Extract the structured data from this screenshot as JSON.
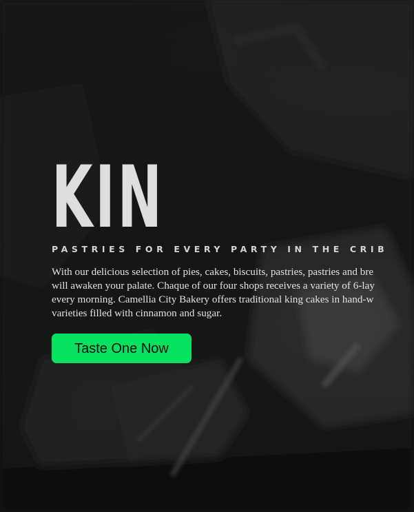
{
  "hero": {
    "title": "KIN",
    "subtitle": "PASTRIES FOR EVERY PARTY IN THE CRIB",
    "description_lines": [
      "With our delicious selection of pies, cakes, biscuits, pastries, pastries and bre",
      "will awaken your palate. Chaque of our four shops receives a variety of 6-lay",
      "every morning. Camellia City Bakery offers traditional king cakes in hand-w",
      "varieties filled with cinnamon and sugar."
    ],
    "cta_label": "Taste One Now"
  },
  "colors": {
    "accent": "#06e25f",
    "background": "#151515",
    "title": "#dedede"
  }
}
